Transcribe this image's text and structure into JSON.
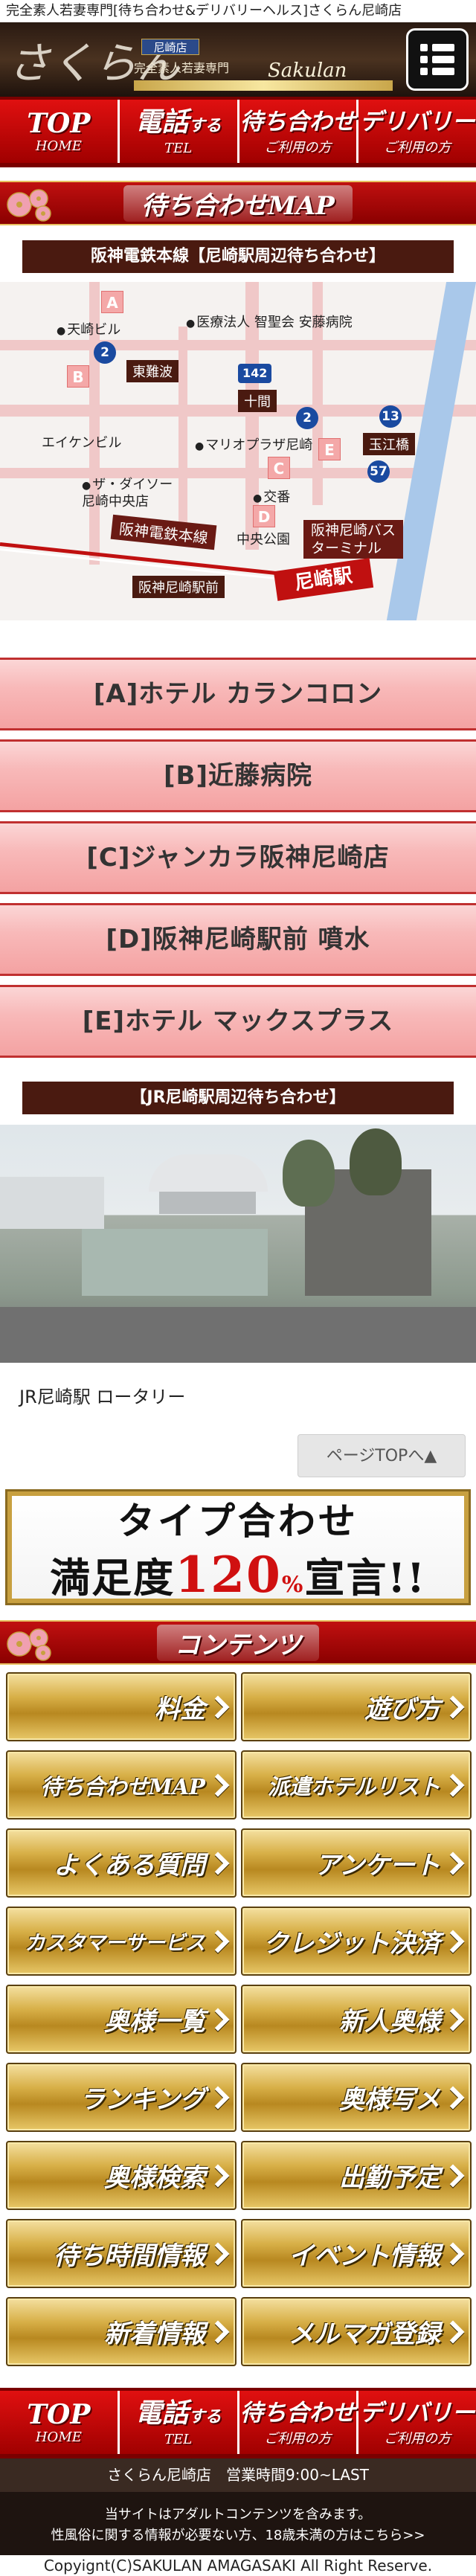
{
  "topline": "完全素人若妻専門[待ち合わせ&デリバリーヘルス]さくらん尼崎店",
  "header": {
    "logo_script": "さくらん",
    "store_badge": "尼崎店",
    "store_sub": "完全素人若妻専門",
    "brand_script": "Sakulan"
  },
  "nav": [
    {
      "main": "TOP",
      "sub": "HOME"
    },
    {
      "main": "電話",
      "main_small": "する",
      "sub": "TEL"
    },
    {
      "main": "待ち合わせ",
      "sub": "ご利用の方"
    },
    {
      "main": "デリバリー",
      "sub": "ご利用の方"
    }
  ],
  "map_section": {
    "title": "待ち合わせMAP",
    "line_label": "阪神電鉄本線【尼崎駅周辺待ち合わせ】",
    "map_labels": {
      "iryo": "医療法人 智聖会 安藤病院",
      "amabiru": "天崎ビル",
      "tonanba": "東難波",
      "r142": "142",
      "jikken": "十間",
      "r2": "2",
      "r13": "13",
      "tamae": "玉江橋",
      "r57": "57",
      "eiken": "エイケンビル",
      "mario": "マリオプラザ尼崎",
      "daiso": "ザ・ダイソー\n尼崎中央店",
      "koban": "交番",
      "chuo": "中央公園",
      "hanshin_line": "阪神電鉄本線",
      "bus": "阪神尼崎バス\nターミナル",
      "ekimae": "阪神尼崎駅前",
      "station": "尼崎駅"
    }
  },
  "locations": [
    "[A]ホテル カランコロン",
    "[B]近藤病院",
    "[C]ジャンカラ阪神尼崎店",
    "[D]阪神尼崎駅前 噴水",
    "[E]ホテル マックスプラス"
  ],
  "jr_label": "【JR尼崎駅周辺待ち合わせ】",
  "photo_caption": "JR尼崎駅 ロータリー",
  "totop": "ページTOPへ▲",
  "banner": {
    "line1": "タイプ合わせ",
    "line2_pre": "満足度",
    "line2_num": "120",
    "line2_pct": "%",
    "line2_post": "宣言!!"
  },
  "contents_title": "コンテンツ",
  "grid": [
    "料金",
    "遊び方",
    "待ち合わせMAP",
    "派遣ホテルリスト",
    "よくある質問",
    "アンケート",
    "カスタマーサービス",
    "クレジット決済",
    "奥様一覧",
    "新人奥様",
    "ランキング",
    "奥様写メ",
    "奥様検索",
    "出勤予定",
    "待ち時間情報",
    "イベント情報",
    "新着情報",
    "メルマガ登録"
  ],
  "footer": {
    "info": "さくらん尼崎店　営業時間9:00~LAST",
    "warn1": "当サイトはアダルトコンテンツを含みます。",
    "warn2": "性風俗に関する情報が必要ない方、18歳未満の方はこちら>>",
    "copyright": "Copyignt(C)SAKULAN AMAGASAKI All Right Reserve."
  },
  "colors": {
    "accent": "#c01010",
    "gold": "#c8a040",
    "pink": "#f8b9b9",
    "dark": "#4a1a10"
  }
}
